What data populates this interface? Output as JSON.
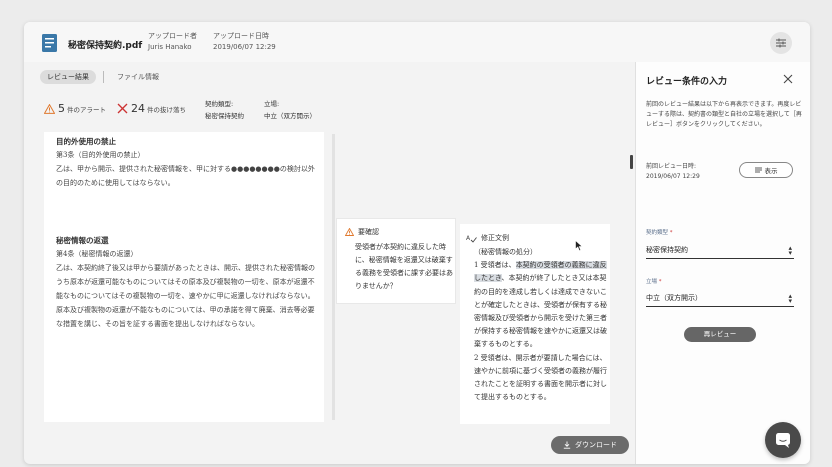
{
  "header": {
    "file_name": "秘密保持契約.pdf",
    "uploader_label": "アップロード者",
    "uploader_value": "Juris Hanako",
    "upload_date_label": "アップロード日時",
    "upload_date_value": "2019/06/07 12:29"
  },
  "tabs": {
    "review_result": "レビュー結果",
    "file_info": "ファイル情報"
  },
  "alerts": {
    "alert_count": "5",
    "alert_unit": "件のアラート",
    "missing_count": "24",
    "missing_unit": "件の抜け落ち"
  },
  "contract_info": {
    "type_label": "契約類型:",
    "type_value": "秘密保持契約",
    "position_label": "立場:",
    "position_value": "中立（双方開示）"
  },
  "document": {
    "section1_heading": "目的外使用の禁止",
    "section1_article": "第3条（目的外使用の禁止）",
    "section1_text": "乙は、甲から開示、提供された秘密情報を、甲に対する●●●●●●●●の検討以外の目的のために使用してはならない。",
    "section2_heading": "秘密情報の返還",
    "section2_article": "第4条（秘密情報の返還）",
    "section2_text": "乙は、本契約終了後又は甲から要請があったときは、開示、提供された秘密情報のうち原本が返還可能なものについてはその原本及び複製物の一切を、原本が返還不能なものについてはその複製物の一切を、速やかに甲に返還しなければならない。原本及び複製物の返還が不能なものについては、甲の承諾を得て廃棄、消去等必要な措置を講じ、その旨を証する書面を提出しなければならない。"
  },
  "confirm": {
    "title": "要確認",
    "body": "受領者が本契約に違反した時に、秘密情報を返還又は破棄する義務を受領者に課す必要はありませんか？"
  },
  "revision": {
    "title": "修正文例",
    "heading": "（秘密情報の処分）",
    "p1_start": "1 受領者は、",
    "p1_highlight": "本契約の受領者の義務に違反したとき",
    "p1_end": "、本契約が終了したとき又は本契約の目的を達成し若しくは達成できないことが確定したときは、受領者が保有する秘密情報及び受領者から開示を受けた第三者が保持する秘密情報を速やかに返還又は破棄するものとする。",
    "p2": "2 受領者は、開示者が要請した場合には、速やかに前項に基づく受領者の義務が履行されたことを証明する書面を開示者に対して提出するものとする。"
  },
  "download_label": "ダウンロード",
  "panel": {
    "title": "レビュー条件の入力",
    "description": "前回のレビュー結果は以下から再表示できます。再度レビューする際は、契約書の類型と自社の立場を選択して［再レビュー］ボタンをクリックしてください。",
    "prev_label": "前回レビュー日時:",
    "prev_value": "2019/06/07 12:29",
    "show_label": "表示",
    "type_label": "契約類型",
    "type_value": "秘密保持契約",
    "position_label": "立場",
    "position_value": "中立（双方開示）",
    "re_review_label": "再レビュー"
  },
  "colors": {
    "accent": "#5a6e8a",
    "warning": "#e07a30",
    "error": "#cc3333",
    "highlight": "#d9dde2"
  }
}
